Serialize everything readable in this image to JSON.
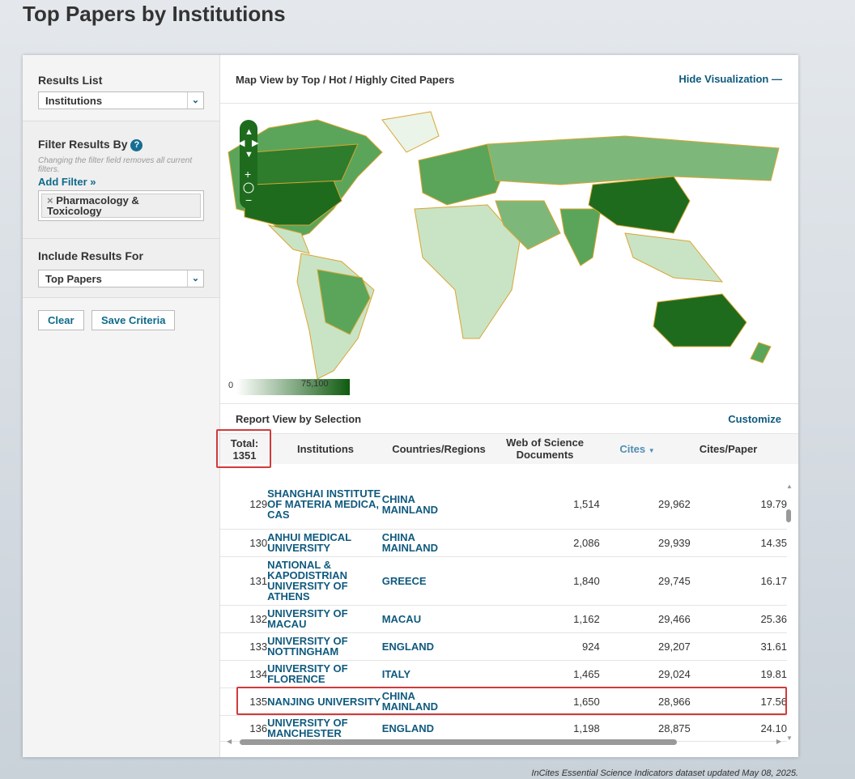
{
  "page": {
    "title": "Top Papers by Institutions",
    "footer": "InCites Essential Science Indicators dataset updated May 08, 2025."
  },
  "sidebar": {
    "results_list_label": "Results List",
    "results_list_value": "Institutions",
    "filter_label": "Filter Results By",
    "filter_note": "Changing the filter field removes all current filters.",
    "add_filter": "Add Filter »",
    "filter_chip": "Pharmacology & Toxicology",
    "include_label": "Include Results For",
    "include_value": "Top Papers",
    "clear": "Clear",
    "save": "Save Criteria"
  },
  "map": {
    "title": "Map View by Top / Hot / Highly Cited Papers",
    "hide": "Hide Visualization",
    "legend_min": "0",
    "legend_max": "75,100",
    "colors": {
      "dark": "#1e6b1e",
      "mid": "#5aa55a",
      "light": "#c9e4c5",
      "border": "#d9a531"
    }
  },
  "report": {
    "title": "Report View by Selection",
    "customize": "Customize",
    "total_label": "Total:",
    "total": "1351",
    "columns": [
      "Institutions",
      "Countries/Regions",
      "Web of Science Documents",
      "Cites",
      "Cites/Paper"
    ],
    "rows": [
      {
        "rank": "129",
        "inst": "SHANGHAI INSTITUTE OF MATERIA MEDICA, CAS",
        "country": "CHINA MAINLAND",
        "docs": "1,514",
        "cites": "29,962",
        "cpp": "19.79"
      },
      {
        "rank": "130",
        "inst": "ANHUI MEDICAL UNIVERSITY",
        "country": "CHINA MAINLAND",
        "docs": "2,086",
        "cites": "29,939",
        "cpp": "14.35"
      },
      {
        "rank": "131",
        "inst": "NATIONAL & KAPODISTRIAN UNIVERSITY OF ATHENS",
        "country": "GREECE",
        "docs": "1,840",
        "cites": "29,745",
        "cpp": "16.17"
      },
      {
        "rank": "132",
        "inst": "UNIVERSITY OF MACAU",
        "country": "MACAU",
        "docs": "1,162",
        "cites": "29,466",
        "cpp": "25.36"
      },
      {
        "rank": "133",
        "inst": "UNIVERSITY OF NOTTINGHAM",
        "country": "ENGLAND",
        "docs": "924",
        "cites": "29,207",
        "cpp": "31.61"
      },
      {
        "rank": "134",
        "inst": "UNIVERSITY OF FLORENCE",
        "country": "ITALY",
        "docs": "1,465",
        "cites": "29,024",
        "cpp": "19.81"
      },
      {
        "rank": "135",
        "inst": "NANJING UNIVERSITY",
        "country": "CHINA MAINLAND",
        "docs": "1,650",
        "cites": "28,966",
        "cpp": "17.56"
      },
      {
        "rank": "136",
        "inst": "UNIVERSITY OF MANCHESTER",
        "country": "ENGLAND",
        "docs": "1,198",
        "cites": "28,875",
        "cpp": "24.10"
      }
    ]
  }
}
